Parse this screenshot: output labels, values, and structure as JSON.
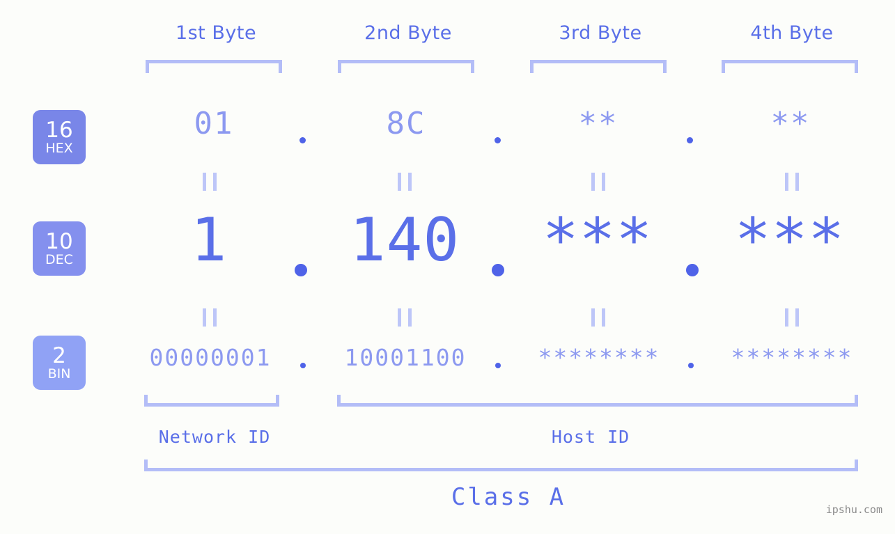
{
  "bytes": [
    {
      "header": "1st Byte"
    },
    {
      "header": "2nd Byte"
    },
    {
      "header": "3rd Byte"
    },
    {
      "header": "4th Byte"
    }
  ],
  "rows": [
    {
      "base": "16",
      "abbr": "HEX",
      "values": [
        "01",
        "8C",
        "**",
        "**"
      ],
      "separator": "."
    },
    {
      "base": "10",
      "abbr": "DEC",
      "values": [
        "1",
        "140",
        "***",
        "***"
      ],
      "separator": "."
    },
    {
      "base": "2",
      "abbr": "BIN",
      "values": [
        "00000001",
        "10001100",
        "********",
        "********"
      ],
      "separator": "."
    }
  ],
  "connector": "=",
  "sections": {
    "network_id": "Network ID",
    "host_id": "Host ID"
  },
  "class_label": "Class A",
  "watermark": "ipshu.com",
  "colors": {
    "background": "#fcfdfa",
    "accent_strong": "#5a6fe8",
    "accent_mid": "#8c99f0",
    "accent_light": "#b3bdf7",
    "badge_hex": "#7986e8",
    "badge_dec": "#8490ee",
    "badge_bin": "#90a2f5",
    "dot": "#4f63e8",
    "watermark": "#8b8b8b"
  }
}
